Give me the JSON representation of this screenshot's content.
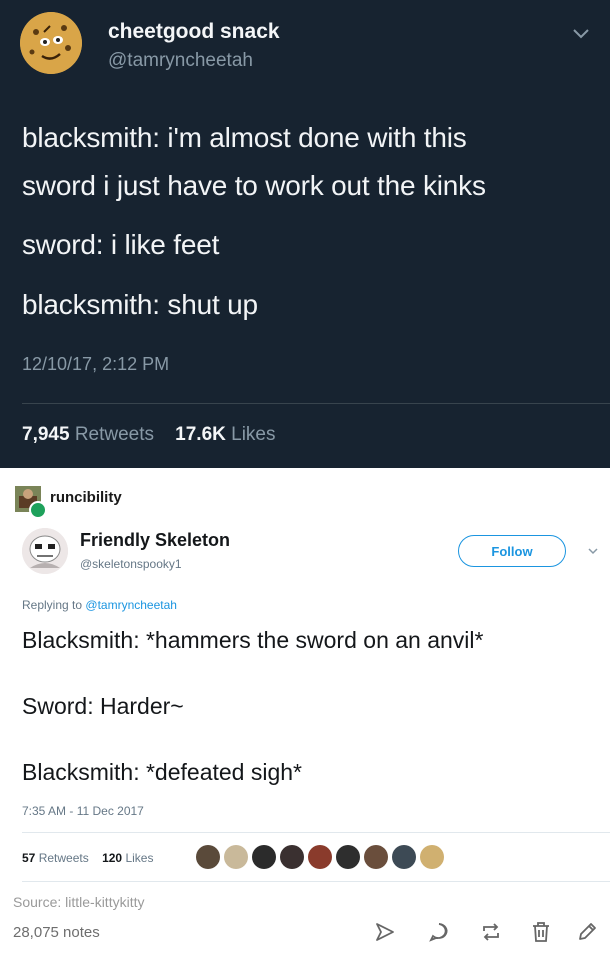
{
  "tweet": {
    "display_name": "cheetgood snack",
    "handle": "@tamryncheetah",
    "lines": [
      "blacksmith: i'm almost done with this",
      "sword i just have to work out the kinks",
      "sword: i like feet",
      "blacksmith: shut up"
    ],
    "timestamp": "12/10/17, 2:12 PM",
    "retweets_count": "7,945",
    "retweets_label": "Retweets",
    "likes_count": "17.6K",
    "likes_label": "Likes"
  },
  "post": {
    "reblogger": "runcibility",
    "author_name": "Friendly Skeleton",
    "author_handle": "@skeletonspooky1",
    "follow_label": "Follow",
    "replying_prefix": "Replying to",
    "replying_to": "@tamryncheetah",
    "lines": [
      "Blacksmith: *hammers the sword on an anvil*",
      "Sword: Harder~",
      "Blacksmith: *defeated sigh*"
    ],
    "timestamp": "7:35 AM - 11 Dec 2017",
    "retweets_count": "57",
    "retweets_label": "Retweets",
    "likes_count": "120",
    "likes_label": "Likes",
    "source": "Source: little-kittykitty",
    "notes": "28,075 notes"
  },
  "icons": {
    "tweet_menu": "chevron-down-icon",
    "post_menu": "chevron-down-icon",
    "share": "send-icon",
    "reply": "reply-bubble-icon",
    "reblog": "reblog-icon",
    "delete": "trash-icon",
    "edit": "pencil-icon"
  },
  "colors": {
    "tweet_bg": "#172330",
    "link_blue": "#1b95e0",
    "liker_faces": [
      "#5a4a3a",
      "#c9b99a",
      "#2b2b2b",
      "#3a3030",
      "#8a3b2c",
      "#2e2e2e",
      "#6a4e3c",
      "#3d4a55",
      "#d0b070"
    ]
  }
}
